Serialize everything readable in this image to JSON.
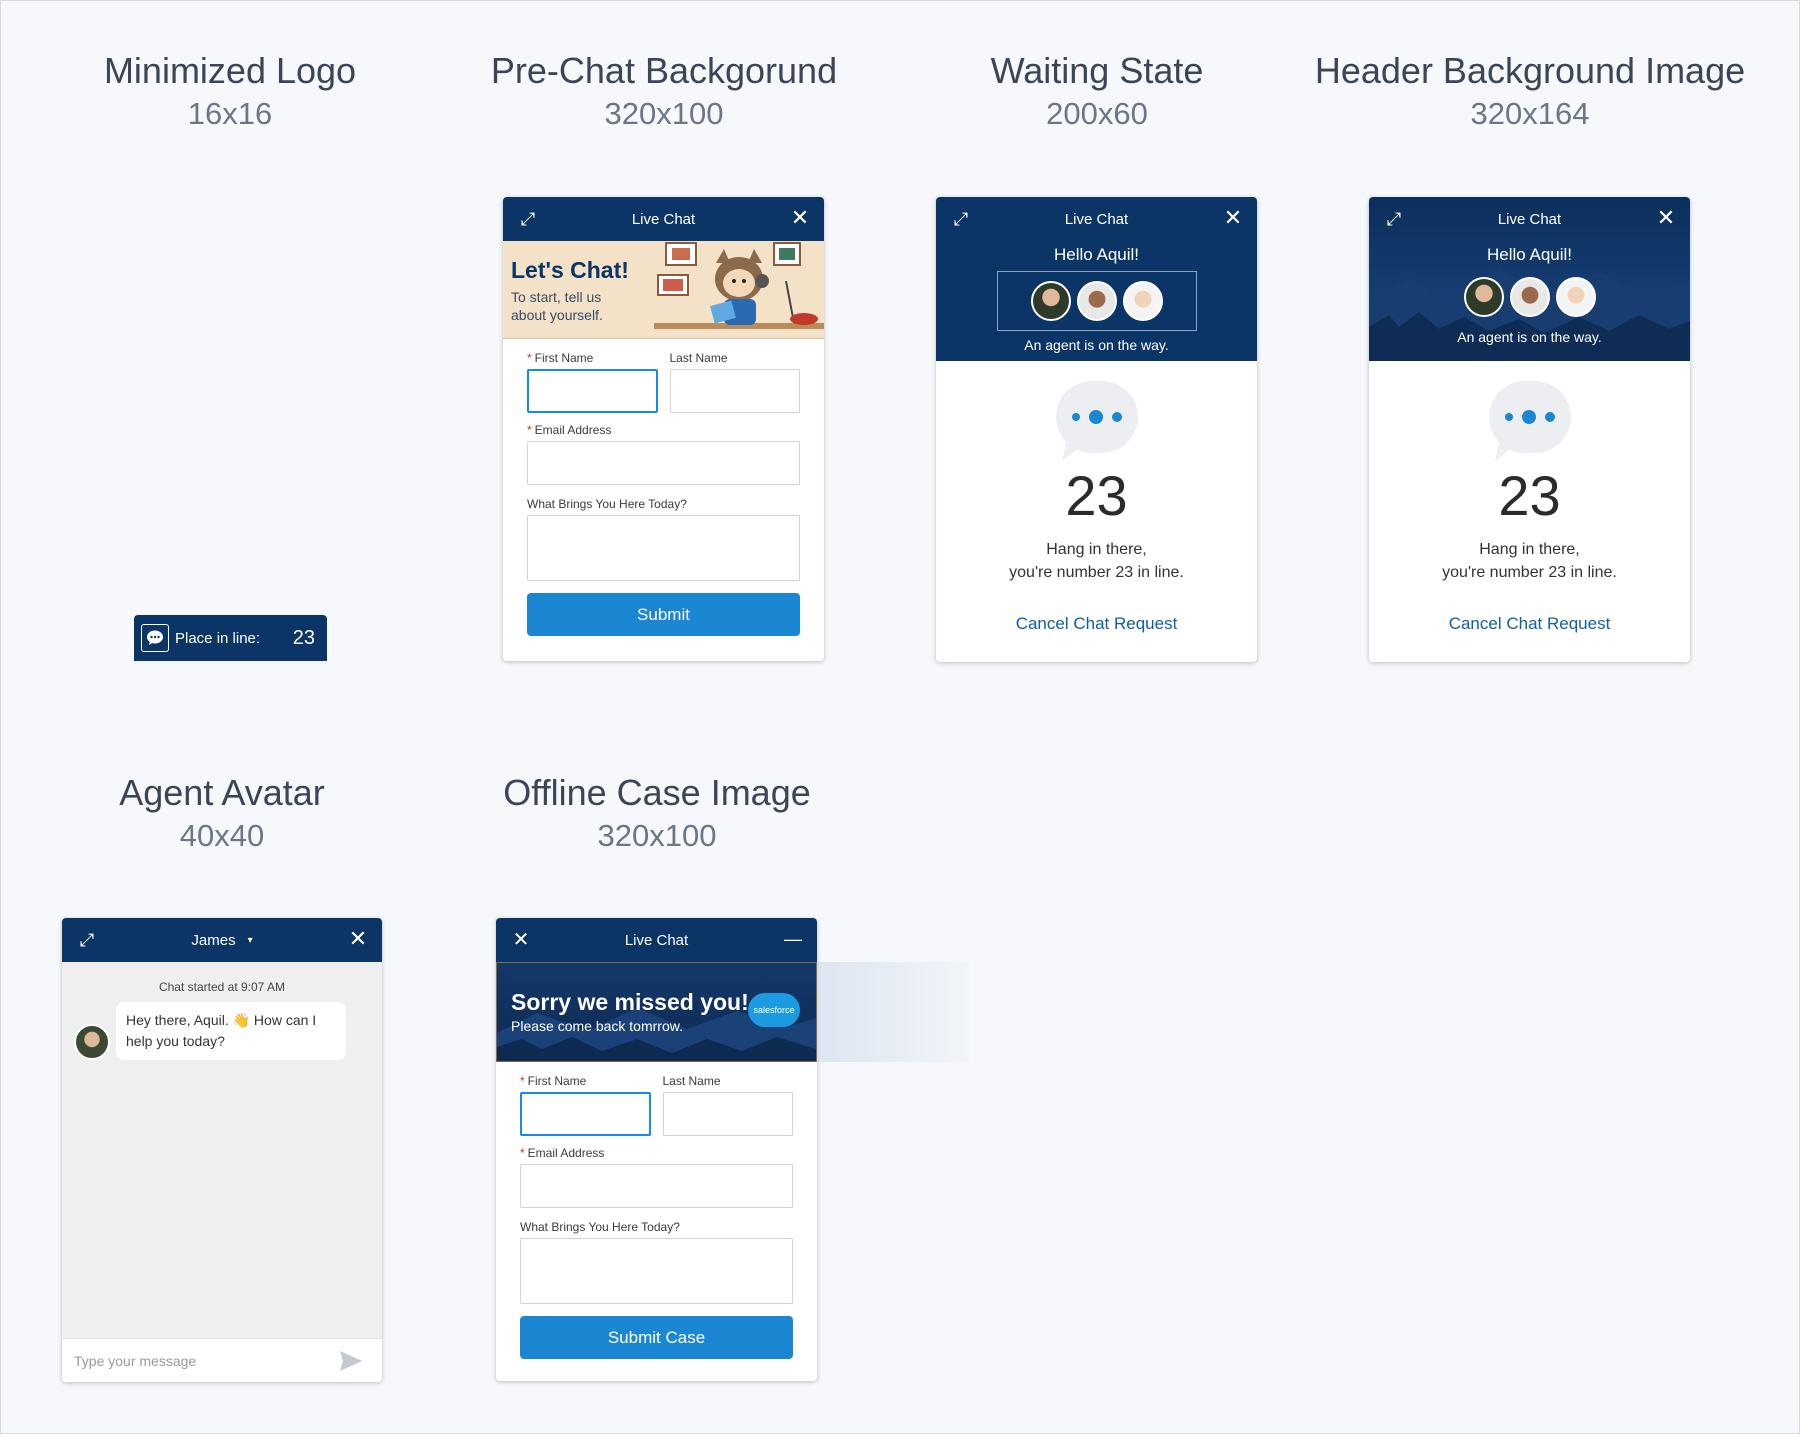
{
  "sections": {
    "minimized": {
      "title": "Minimized Logo",
      "size": "16x16"
    },
    "prechat": {
      "title": "Pre-Chat Backgorund",
      "size": "320x100"
    },
    "waiting": {
      "title": "Waiting State",
      "size": "200x60"
    },
    "header_bg": {
      "title": "Header Background Image",
      "size": "320x164"
    },
    "agent": {
      "title": "Agent Avatar",
      "size": "40x40"
    },
    "offline": {
      "title": "Offline Case Image",
      "size": "320x100"
    }
  },
  "minimized_bar": {
    "label": "Place in line:",
    "count": "23",
    "bg": "#0b3566"
  },
  "prechat_window": {
    "header_title": "Live Chat",
    "banner_title": "Let's Chat!",
    "banner_sub_1": "To start, tell us",
    "banner_sub_2": "about yourself.",
    "first_name": "First Name",
    "last_name": "Last Name",
    "email": "Email Address",
    "reason": "What Brings You Here Today?",
    "submit": "Submit"
  },
  "waiting_window": {
    "header_title": "Live Chat",
    "greeting": "Hello Aquil!",
    "agent_msg": "An agent is on the way.",
    "queue_number": "23",
    "hang_1": "Hang in there,",
    "hang_2": "you're number 23 in line.",
    "cancel": "Cancel Chat Request"
  },
  "header_bg_window": {
    "header_title": "Live Chat",
    "greeting": "Hello Aquil!",
    "agent_msg": "An agent is on the way.",
    "queue_number": "23",
    "hang_1": "Hang in there,",
    "hang_2": "you're number 23 in line.",
    "cancel": "Cancel Chat Request"
  },
  "agent_window": {
    "agent_name": "James",
    "chat_started": "Chat started at 9:07 AM",
    "message_1": "Hey there, Aquil. 👋 How can I",
    "message_2": "help you today?",
    "input_placeholder": "Type your message"
  },
  "offline_window": {
    "header_title": "Live Chat",
    "banner_title": "Sorry we missed you!",
    "banner_sub": "Please come back tomrrow.",
    "logo_text": "salesforce",
    "first_name": "First Name",
    "last_name": "Last Name",
    "email": "Email Address",
    "reason": "What Brings You Here Today?",
    "submit": "Submit Case"
  },
  "colors": {
    "header": "#0b3566",
    "button": "#1b86d1",
    "link": "#0f5ea8",
    "page_bg": "#f6f8fb"
  }
}
